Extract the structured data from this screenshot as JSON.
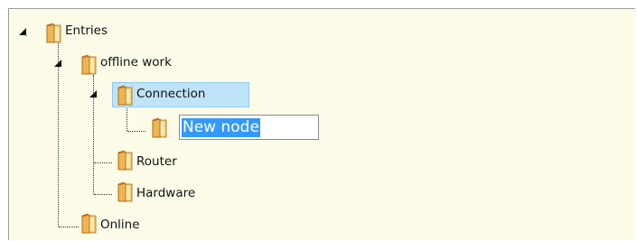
{
  "tree": {
    "root": {
      "label": "Entries",
      "icon": "folder-icon",
      "expanded": true,
      "children": [
        {
          "label": "offline work",
          "icon": "folder-icon",
          "expanded": true,
          "children": [
            {
              "label": "Connection",
              "icon": "folder-icon",
              "expanded": true,
              "selected": true,
              "children": [
                {
                  "label": "New node",
                  "icon": "folder-icon",
                  "editing": true
                }
              ]
            },
            {
              "label": "Router",
              "icon": "folder-icon"
            },
            {
              "label": "Hardware",
              "icon": "folder-icon"
            }
          ]
        },
        {
          "label": "Online",
          "icon": "folder-icon"
        }
      ]
    }
  },
  "colors": {
    "tree_background": "#fcfce8",
    "selection_background": "#bfe4f9",
    "edit_selection": "#3399ff",
    "border": "#9c9c9c"
  }
}
